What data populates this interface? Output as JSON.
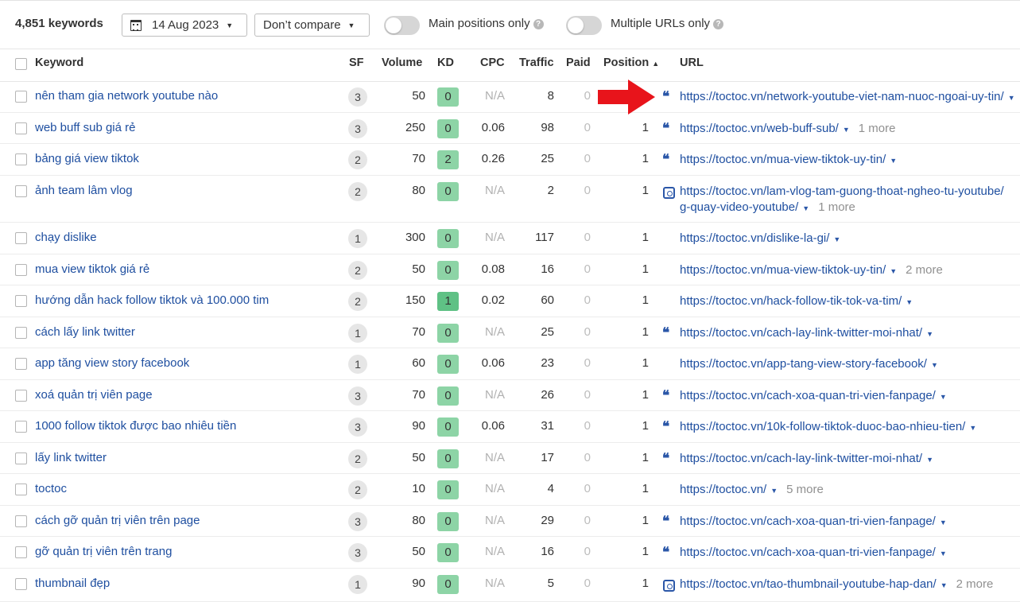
{
  "toolbar": {
    "keyword_count": "4,851 keywords",
    "date": "14 Aug 2023",
    "compare": "Don’t compare",
    "main_positions_label": "Main positions only",
    "multiple_urls_label": "Multiple URLs only",
    "help_glyph": "?"
  },
  "columns": {
    "keyword": "Keyword",
    "sf": "SF",
    "volume": "Volume",
    "kd": "KD",
    "cpc": "CPC",
    "traffic": "Traffic",
    "paid": "Paid",
    "position": "Position",
    "position_sort": "▲",
    "url": "URL"
  },
  "rows": [
    {
      "keyword": "nên tham gia network youtube nào",
      "sf": "3",
      "volume": "50",
      "kd": "0",
      "cpc": "N/A",
      "traffic": "8",
      "paid": "0",
      "position": "",
      "icon": "quote-icon",
      "url": "https://toctoc.vn/network-youtube-viet-nam-nuoc-ngoai-uy-tin/",
      "more": ""
    },
    {
      "keyword": "web buff sub giá rẻ",
      "sf": "3",
      "volume": "250",
      "kd": "0",
      "cpc": "0.06",
      "traffic": "98",
      "paid": "0",
      "position": "1",
      "icon": "quote-icon",
      "url": "https://toctoc.vn/web-buff-sub/",
      "more": "1 more"
    },
    {
      "keyword": "bảng giá view tiktok",
      "sf": "2",
      "volume": "70",
      "kd": "2",
      "cpc": "0.26",
      "traffic": "25",
      "paid": "0",
      "position": "1",
      "icon": "quote-icon",
      "url": "https://toctoc.vn/mua-view-tiktok-uy-tin/",
      "more": ""
    },
    {
      "keyword": "ảnh team lâm vlog",
      "sf": "2",
      "volume": "80",
      "kd": "0",
      "cpc": "N/A",
      "traffic": "2",
      "paid": "0",
      "position": "1",
      "icon": "video-icon",
      "url": "https://toctoc.vn/lam-vlog-tam-guong-thoat-ngheo-tu-youtube/",
      "url_line2": "g-quay-video-youtube/",
      "more": "1 more"
    },
    {
      "keyword": "chạy dislike",
      "sf": "1",
      "volume": "300",
      "kd": "0",
      "cpc": "N/A",
      "traffic": "117",
      "paid": "0",
      "position": "1",
      "icon": "",
      "url": "https://toctoc.vn/dislike-la-gi/",
      "more": ""
    },
    {
      "keyword": "mua view tiktok giá rẻ",
      "sf": "2",
      "volume": "50",
      "kd": "0",
      "cpc": "0.08",
      "traffic": "16",
      "paid": "0",
      "position": "1",
      "icon": "",
      "url": "https://toctoc.vn/mua-view-tiktok-uy-tin/",
      "more": "2 more"
    },
    {
      "keyword": "hướng dẫn hack follow tiktok và 100.000 tim",
      "sf": "2",
      "volume": "150",
      "kd": "1",
      "cpc": "0.02",
      "traffic": "60",
      "paid": "0",
      "position": "1",
      "icon": "",
      "url": "https://toctoc.vn/hack-follow-tik-tok-va-tim/",
      "more": ""
    },
    {
      "keyword": "cách lấy link twitter",
      "sf": "1",
      "volume": "70",
      "kd": "0",
      "cpc": "N/A",
      "traffic": "25",
      "paid": "0",
      "position": "1",
      "icon": "quote-icon",
      "url": "https://toctoc.vn/cach-lay-link-twitter-moi-nhat/",
      "more": ""
    },
    {
      "keyword": "app tăng view story facebook",
      "sf": "1",
      "volume": "60",
      "kd": "0",
      "cpc": "0.06",
      "traffic": "23",
      "paid": "0",
      "position": "1",
      "icon": "",
      "url": "https://toctoc.vn/app-tang-view-story-facebook/",
      "more": ""
    },
    {
      "keyword": "xoá quản trị viên page",
      "sf": "3",
      "volume": "70",
      "kd": "0",
      "cpc": "N/A",
      "traffic": "26",
      "paid": "0",
      "position": "1",
      "icon": "quote-icon",
      "url": "https://toctoc.vn/cach-xoa-quan-tri-vien-fanpage/",
      "more": ""
    },
    {
      "keyword": "1000 follow tiktok được bao nhiêu tiền",
      "sf": "3",
      "volume": "90",
      "kd": "0",
      "cpc": "0.06",
      "traffic": "31",
      "paid": "0",
      "position": "1",
      "icon": "quote-icon",
      "url": "https://toctoc.vn/10k-follow-tiktok-duoc-bao-nhieu-tien/",
      "more": ""
    },
    {
      "keyword": "lấy link twitter",
      "sf": "2",
      "volume": "50",
      "kd": "0",
      "cpc": "N/A",
      "traffic": "17",
      "paid": "0",
      "position": "1",
      "icon": "quote-icon",
      "url": "https://toctoc.vn/cach-lay-link-twitter-moi-nhat/",
      "more": ""
    },
    {
      "keyword": "toctoc",
      "sf": "2",
      "volume": "10",
      "kd": "0",
      "cpc": "N/A",
      "traffic": "4",
      "paid": "0",
      "position": "1",
      "icon": "",
      "url": "https://toctoc.vn/",
      "more": "5 more"
    },
    {
      "keyword": "cách gỡ quản trị viên trên page",
      "sf": "3",
      "volume": "80",
      "kd": "0",
      "cpc": "N/A",
      "traffic": "29",
      "paid": "0",
      "position": "1",
      "icon": "quote-icon",
      "url": "https://toctoc.vn/cach-xoa-quan-tri-vien-fanpage/",
      "more": ""
    },
    {
      "keyword": "gỡ quản trị viên trên trang",
      "sf": "3",
      "volume": "50",
      "kd": "0",
      "cpc": "N/A",
      "traffic": "16",
      "paid": "0",
      "position": "1",
      "icon": "quote-icon",
      "url": "https://toctoc.vn/cach-xoa-quan-tri-vien-fanpage/",
      "more": ""
    },
    {
      "keyword": "thumbnail đẹp",
      "sf": "1",
      "volume": "90",
      "kd": "0",
      "cpc": "N/A",
      "traffic": "5",
      "paid": "0",
      "position": "1",
      "icon": "video-icon",
      "url": "https://toctoc.vn/tao-thumbnail-youtube-hap-dan/",
      "more": "2 more"
    }
  ],
  "colors": {
    "link": "#1f4fa0",
    "kd_easy": "#8dd4a6",
    "kd_1": "#5fc185",
    "annotation_arrow": "#e8141b"
  },
  "annotation": {
    "icon": "red-arrow-icon"
  }
}
